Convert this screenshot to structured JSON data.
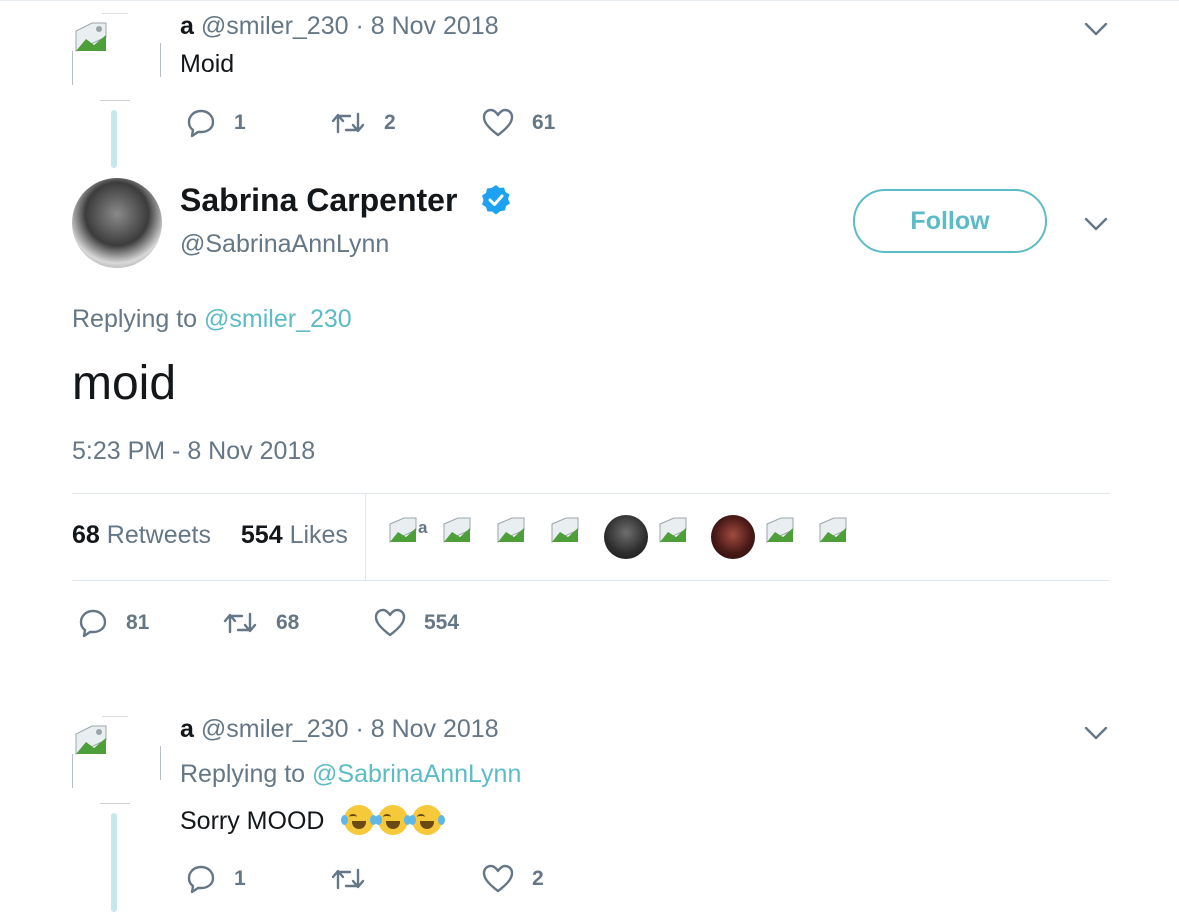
{
  "tweet1": {
    "name": "a",
    "handle": "@smiler_230",
    "date": "· 8 Nov 2018",
    "text": "Moid",
    "replies": "1",
    "retweets": "2",
    "likes": "61"
  },
  "main_tweet": {
    "name": "Sabrina Carpenter",
    "handle": "@SabrinaAnnLynn",
    "follow_label": "Follow",
    "replying_prefix": "Replying to",
    "replying_handle": "@smiler_230",
    "text": "moid",
    "timestamp": "5:23 PM - 8 Nov 2018",
    "retweet_count": "68",
    "retweet_label": "Retweets",
    "like_count": "554",
    "like_label": "Likes",
    "replies": "81",
    "retweets": "68",
    "likes": "554"
  },
  "tweet3": {
    "name": "a",
    "handle": "@smiler_230",
    "date": "· 8 Nov 2018",
    "replying_prefix": "Replying to",
    "replying_handle": "@SabrinaAnnLynn",
    "text": "Sorry MOOD",
    "emoji": "😂😂😂",
    "replies": "1",
    "retweets": "",
    "likes": "2"
  },
  "likers_letter": "a",
  "colors": {
    "accent": "#5cbcc6",
    "muted": "#657786",
    "verified": "#1da1f2",
    "thread": "#c4e9ec"
  },
  "icons": [
    "reply-icon",
    "retweet-icon",
    "heart-icon",
    "chevron-down-icon",
    "verified-badge-icon",
    "broken-image-icon"
  ]
}
